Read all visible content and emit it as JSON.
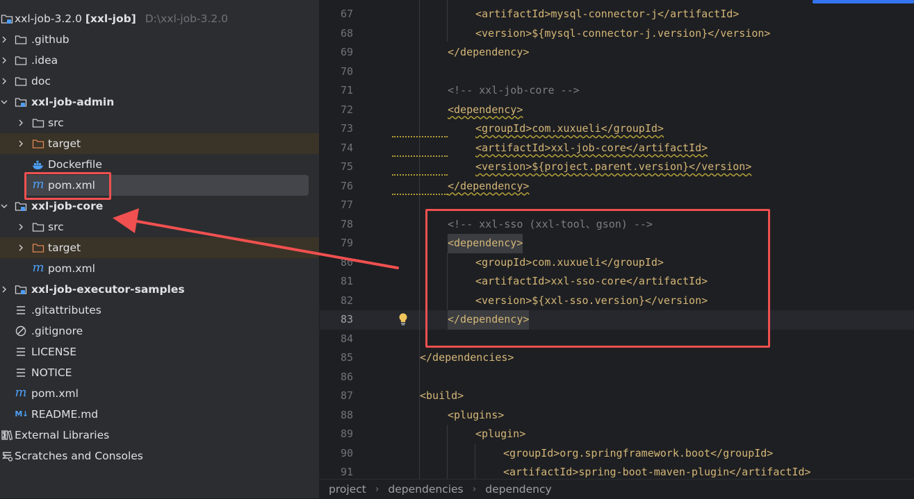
{
  "project_tree": {
    "root": {
      "name": "xxl-job-3.2.0",
      "module": "[xxl-job]",
      "path": "D:\\xxl-job-3.2.0"
    },
    "items": [
      {
        "label": "xxl-job-3.2.0 [xxl-job]",
        "icon": "module-folder-icon"
      },
      {
        "label": ".github",
        "icon": "folder-icon"
      },
      {
        "label": ".idea",
        "icon": "folder-icon"
      },
      {
        "label": "doc",
        "icon": "folder-icon"
      },
      {
        "label": "xxl-job-admin",
        "icon": "module-folder-icon"
      },
      {
        "label": "src",
        "icon": "folder-icon"
      },
      {
        "label": "target",
        "icon": "excluded-folder-icon"
      },
      {
        "label": "Dockerfile",
        "icon": "docker-icon"
      },
      {
        "label": "pom.xml",
        "icon": "maven-icon"
      },
      {
        "label": "xxl-job-core",
        "icon": "module-folder-icon"
      },
      {
        "label": "src",
        "icon": "folder-icon"
      },
      {
        "label": "target",
        "icon": "excluded-folder-icon"
      },
      {
        "label": "pom.xml",
        "icon": "maven-icon"
      },
      {
        "label": "xxl-job-executor-samples",
        "icon": "module-folder-icon"
      },
      {
        "label": ".gitattributes",
        "icon": "text-file-icon"
      },
      {
        "label": ".gitignore",
        "icon": "ignore-file-icon"
      },
      {
        "label": "LICENSE",
        "icon": "text-file-icon"
      },
      {
        "label": "NOTICE",
        "icon": "text-file-icon"
      },
      {
        "label": "pom.xml",
        "icon": "maven-icon"
      },
      {
        "label": "README.md",
        "icon": "markdown-icon"
      },
      {
        "label": "External Libraries",
        "icon": "libraries-icon"
      },
      {
        "label": "Scratches and Consoles",
        "icon": "scratches-icon"
      }
    ]
  },
  "editor": {
    "lines": [
      {
        "num": "67",
        "text": "<artifactId>mysql-connector-j</artifactId>"
      },
      {
        "num": "68",
        "text": "<version>${mysql-connector-j.version}</version>"
      },
      {
        "num": "69",
        "text": "</dependency>"
      },
      {
        "num": "70",
        "text": ""
      },
      {
        "num": "71",
        "text": "<!-- xxl-job-core -->"
      },
      {
        "num": "72",
        "text": "<dependency>"
      },
      {
        "num": "73",
        "text": "<groupId>com.xuxueli</groupId>"
      },
      {
        "num": "74",
        "text": "<artifactId>xxl-job-core</artifactId>"
      },
      {
        "num": "75",
        "text": "<version>${project.parent.version}</version>"
      },
      {
        "num": "76",
        "text": "</dependency>"
      },
      {
        "num": "77",
        "text": ""
      },
      {
        "num": "78",
        "text": "<!-- xxl-sso (xxl-tool、gson) -->"
      },
      {
        "num": "79",
        "text": "<dependency>"
      },
      {
        "num": "80",
        "text": "<groupId>com.xuxueli</groupId>"
      },
      {
        "num": "81",
        "text": "<artifactId>xxl-sso-core</artifactId>"
      },
      {
        "num": "82",
        "text": "<version>${xxl-sso.version}</version>"
      },
      {
        "num": "83",
        "text": "</dependency>"
      },
      {
        "num": "84",
        "text": ""
      },
      {
        "num": "85",
        "text": "</dependencies>"
      },
      {
        "num": "86",
        "text": ""
      },
      {
        "num": "87",
        "text": "<build>"
      },
      {
        "num": "88",
        "text": "<plugins>"
      },
      {
        "num": "89",
        "text": "<plugin>"
      },
      {
        "num": "90",
        "text": "<groupId>org.springframework.boot</groupId>"
      },
      {
        "num": "91",
        "text": "<artifactId>spring-boot-maven-plugin</artifactId>"
      }
    ],
    "intention_icon": "lightbulb-icon"
  },
  "breadcrumb": [
    "project",
    "dependencies",
    "dependency"
  ],
  "colors": {
    "tag": "#d5b778",
    "text": "#bcbec4",
    "comment": "#7a7e85",
    "annotation": "#f05050",
    "accent": "#3574f0"
  }
}
